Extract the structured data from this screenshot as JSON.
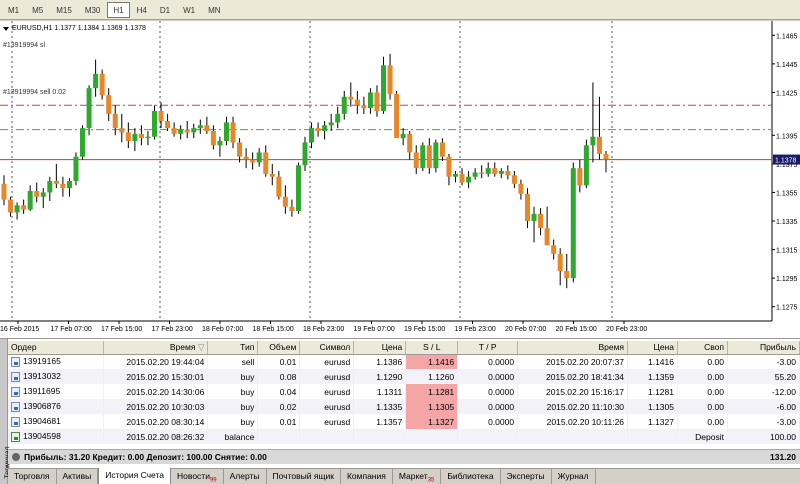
{
  "timeframes": [
    {
      "label": "M1",
      "active": false
    },
    {
      "label": "M5",
      "active": false
    },
    {
      "label": "M15",
      "active": false
    },
    {
      "label": "M30",
      "active": false
    },
    {
      "label": "H1",
      "active": true
    },
    {
      "label": "H4",
      "active": false
    },
    {
      "label": "D1",
      "active": false
    },
    {
      "label": "W1",
      "active": false
    },
    {
      "label": "MN",
      "active": false
    }
  ],
  "chart": {
    "title": "EURUSD,H1  1.1377 1.1384 1.1369 1.1378",
    "sl_label": "#13919994 sl",
    "order_label": "#13919994 sell 0.02",
    "current_price": "1.1378",
    "colors": {
      "bull": "#2ea82e",
      "bear": "#e8862a",
      "sl_line": "#cc4444",
      "order_line": "#44aa44",
      "bid_line": "#c04040"
    }
  },
  "chart_data": {
    "type": "candlestick",
    "symbol": "EURUSD",
    "timeframe": "H1",
    "ylim": [
      1.1265,
      1.1475
    ],
    "y_ticks": [
      "1.1465",
      "1.1445",
      "1.1425",
      "1.1395",
      "1.1375",
      "1.1355",
      "1.1335",
      "1.1315",
      "1.1295",
      "1.1275"
    ],
    "x_ticks": [
      "16 Feb 2015",
      "17 Feb 07:00",
      "17 Feb 15:00",
      "17 Feb 23:00",
      "18 Feb 07:00",
      "18 Feb 15:00",
      "18 Feb 23:00",
      "19 Feb 07:00",
      "19 Feb 15:00",
      "19 Feb 23:00",
      "20 Feb 07:00",
      "20 Feb 15:00",
      "20 Feb 23:00"
    ],
    "levels": {
      "stop_loss": 1.1416,
      "order_open": 1.1399,
      "bid": 1.1378
    },
    "candles": [
      [
        1.1361,
        1.1367,
        1.1346,
        1.135
      ],
      [
        1.135,
        1.1352,
        1.1338,
        1.1341
      ],
      [
        1.1341,
        1.1348,
        1.1336,
        1.1346
      ],
      [
        1.1346,
        1.135,
        1.134,
        1.1343
      ],
      [
        1.1343,
        1.136,
        1.1342,
        1.1356
      ],
      [
        1.1356,
        1.1362,
        1.1348,
        1.1352
      ],
      [
        1.1352,
        1.1358,
        1.1344,
        1.1355
      ],
      [
        1.1355,
        1.1366,
        1.1349,
        1.1363
      ],
      [
        1.1363,
        1.1375,
        1.1358,
        1.1361
      ],
      [
        1.1361,
        1.1366,
        1.1352,
        1.1358
      ],
      [
        1.1358,
        1.1365,
        1.1352,
        1.1363
      ],
      [
        1.1363,
        1.1383,
        1.136,
        1.138
      ],
      [
        1.138,
        1.1402,
        1.1378,
        1.14
      ],
      [
        1.14,
        1.143,
        1.1395,
        1.1428
      ],
      [
        1.1428,
        1.1448,
        1.1422,
        1.1438
      ],
      [
        1.1438,
        1.1441,
        1.142,
        1.1423
      ],
      [
        1.1423,
        1.1428,
        1.1405,
        1.141
      ],
      [
        1.141,
        1.1416,
        1.1395,
        1.14
      ],
      [
        1.14,
        1.141,
        1.139,
        1.1397
      ],
      [
        1.1397,
        1.1404,
        1.1386,
        1.1391
      ],
      [
        1.1391,
        1.14,
        1.1384,
        1.1396
      ],
      [
        1.1396,
        1.1402,
        1.1388,
        1.1393
      ],
      [
        1.1393,
        1.1398,
        1.1388,
        1.1394
      ],
      [
        1.1394,
        1.1416,
        1.1392,
        1.1412
      ],
      [
        1.1412,
        1.1418,
        1.14,
        1.1405
      ],
      [
        1.1405,
        1.141,
        1.1398,
        1.14
      ],
      [
        1.14,
        1.1404,
        1.1394,
        1.1396
      ],
      [
        1.1396,
        1.1402,
        1.1392,
        1.1399
      ],
      [
        1.1399,
        1.1405,
        1.1393,
        1.1397
      ],
      [
        1.1397,
        1.1403,
        1.1393,
        1.14
      ],
      [
        1.14,
        1.1406,
        1.1396,
        1.1402
      ],
      [
        1.1402,
        1.1408,
        1.1396,
        1.1398
      ],
      [
        1.1398,
        1.1402,
        1.1385,
        1.1388
      ],
      [
        1.1388,
        1.1394,
        1.138,
        1.1391
      ],
      [
        1.1391,
        1.1408,
        1.1388,
        1.1404
      ],
      [
        1.1404,
        1.1408,
        1.1386,
        1.139
      ],
      [
        1.139,
        1.1393,
        1.1376,
        1.138
      ],
      [
        1.138,
        1.1386,
        1.1372,
        1.1378
      ],
      [
        1.1378,
        1.1383,
        1.1371,
        1.1376
      ],
      [
        1.1376,
        1.1386,
        1.1373,
        1.1383
      ],
      [
        1.1383,
        1.1388,
        1.1366,
        1.1368
      ],
      [
        1.1368,
        1.1375,
        1.136,
        1.1366
      ],
      [
        1.1366,
        1.137,
        1.135,
        1.1352
      ],
      [
        1.1352,
        1.136,
        1.134,
        1.1345
      ],
      [
        1.1345,
        1.135,
        1.1338,
        1.1342
      ],
      [
        1.1342,
        1.1376,
        1.134,
        1.1374
      ],
      [
        1.1374,
        1.1394,
        1.137,
        1.139
      ],
      [
        1.139,
        1.1404,
        1.1386,
        1.14
      ],
      [
        1.14,
        1.1404,
        1.1394,
        1.1398
      ],
      [
        1.1398,
        1.1405,
        1.1392,
        1.1402
      ],
      [
        1.1402,
        1.141,
        1.1398,
        1.1404
      ],
      [
        1.1404,
        1.1415,
        1.14,
        1.141
      ],
      [
        1.141,
        1.1426,
        1.1406,
        1.1422
      ],
      [
        1.1422,
        1.1432,
        1.1415,
        1.142
      ],
      [
        1.142,
        1.1426,
        1.141,
        1.1416
      ],
      [
        1.1416,
        1.1422,
        1.141,
        1.1414
      ],
      [
        1.1414,
        1.1428,
        1.141,
        1.1425
      ],
      [
        1.1425,
        1.143,
        1.1408,
        1.1412
      ],
      [
        1.1412,
        1.145,
        1.141,
        1.1444
      ],
      [
        1.1444,
        1.1452,
        1.142,
        1.1424
      ],
      [
        1.1424,
        1.1426,
        1.14,
        1.1393
      ],
      [
        1.1393,
        1.14,
        1.1388,
        1.1396
      ],
      [
        1.1396,
        1.1398,
        1.1378,
        1.1383
      ],
      [
        1.1383,
        1.1388,
        1.1368,
        1.1372
      ],
      [
        1.1372,
        1.139,
        1.137,
        1.1388
      ],
      [
        1.1388,
        1.1393,
        1.1368,
        1.1372
      ],
      [
        1.1372,
        1.1392,
        1.1369,
        1.139
      ],
      [
        1.139,
        1.1393,
        1.1377,
        1.138
      ],
      [
        1.138,
        1.1382,
        1.136,
        1.1366
      ],
      [
        1.1366,
        1.137,
        1.1362,
        1.1368
      ],
      [
        1.1368,
        1.1372,
        1.136,
        1.1362
      ],
      [
        1.1362,
        1.137,
        1.1358,
        1.1366
      ],
      [
        1.1366,
        1.1372,
        1.1364,
        1.1369
      ],
      [
        1.1369,
        1.1374,
        1.1365,
        1.1368
      ],
      [
        1.1368,
        1.1376,
        1.1366,
        1.1372
      ],
      [
        1.1372,
        1.1376,
        1.1366,
        1.1368
      ],
      [
        1.1368,
        1.1372,
        1.1365,
        1.137
      ],
      [
        1.137,
        1.1374,
        1.1364,
        1.1367
      ],
      [
        1.1367,
        1.137,
        1.1358,
        1.1361
      ],
      [
        1.1361,
        1.1364,
        1.135,
        1.1354
      ],
      [
        1.1354,
        1.1358,
        1.133,
        1.1335
      ],
      [
        1.1335,
        1.1345,
        1.132,
        1.134
      ],
      [
        1.134,
        1.1344,
        1.1325,
        1.133
      ],
      [
        1.133,
        1.1345,
        1.1322,
        1.1318
      ],
      [
        1.1318,
        1.1322,
        1.1308,
        1.1312
      ],
      [
        1.1312,
        1.1316,
        1.129,
        1.13
      ],
      [
        1.13,
        1.1312,
        1.1288,
        1.1295
      ],
      [
        1.1295,
        1.1376,
        1.1292,
        1.1372
      ],
      [
        1.1372,
        1.1378,
        1.1355,
        1.136
      ],
      [
        1.136,
        1.1392,
        1.1358,
        1.1388
      ],
      [
        1.1388,
        1.1432,
        1.1376,
        1.1394
      ],
      [
        1.1394,
        1.1422,
        1.1378,
        1.1382
      ],
      [
        1.1382,
        1.1384,
        1.1369,
        1.1378
      ]
    ]
  },
  "columns": {
    "order": "Ордер",
    "time": "Время",
    "type": "Тип",
    "volume": "Объем",
    "symbol": "Символ",
    "price": "Цена",
    "sl": "S / L",
    "tp": "T / P",
    "close_time": "Время",
    "close_price": "Цена",
    "swap": "Своп",
    "profit": "Прибыль"
  },
  "rows": [
    {
      "order": "13919165",
      "time": "2015.02.20 19:44:04",
      "type": "sell",
      "volume": "0.01",
      "symbol": "eurusd",
      "price": "1.1386",
      "sl": "1.1416",
      "tp": "0.0000",
      "close_time": "2015.02.20 20:07:37",
      "close_price": "1.1416",
      "swap": "0.00",
      "profit": "-3.00",
      "sl_hit": true,
      "icon": "order"
    },
    {
      "order": "13913032",
      "time": "2015.02.20 15:30:01",
      "type": "buy",
      "volume": "0.08",
      "symbol": "eurusd",
      "price": "1.1290",
      "sl": "1.1260",
      "tp": "0.0000",
      "close_time": "2015.02.20 18:41:34",
      "close_price": "1.1359",
      "swap": "0.00",
      "profit": "55.20",
      "sl_hit": false,
      "icon": "order"
    },
    {
      "order": "13911695",
      "time": "2015.02.20 14:30:06",
      "type": "buy",
      "volume": "0.04",
      "symbol": "eurusd",
      "price": "1.1311",
      "sl": "1.1281",
      "tp": "0.0000",
      "close_time": "2015.02.20 15:16:17",
      "close_price": "1.1281",
      "swap": "0.00",
      "profit": "-12.00",
      "sl_hit": true,
      "icon": "order"
    },
    {
      "order": "13906876",
      "time": "2015.02.20 10:30:03",
      "type": "buy",
      "volume": "0.02",
      "symbol": "eurusd",
      "price": "1.1335",
      "sl": "1.1305",
      "tp": "0.0000",
      "close_time": "2015.02.20 11:10:30",
      "close_price": "1.1305",
      "swap": "0.00",
      "profit": "-6.00",
      "sl_hit": true,
      "icon": "order"
    },
    {
      "order": "13904681",
      "time": "2015.02.20 08:30:14",
      "type": "buy",
      "volume": "0.01",
      "symbol": "eurusd",
      "price": "1.1357",
      "sl": "1.1327",
      "tp": "0.0000",
      "close_time": "2015.02.20 10:11:26",
      "close_price": "1.1327",
      "swap": "0.00",
      "profit": "-3.00",
      "sl_hit": true,
      "icon": "order"
    },
    {
      "order": "13904598",
      "time": "2015.02.20 08:26:32",
      "type": "balance",
      "volume": "",
      "symbol": "",
      "price": "",
      "sl": "",
      "tp": "",
      "close_time": "",
      "close_price": "",
      "swap": "Deposit",
      "profit": "100.00",
      "sl_hit": false,
      "icon": "balance"
    }
  ],
  "summary": {
    "text": "Прибыль: 31.20  Кредит: 0.00  Депозит: 100.00  Снятие: 0.00",
    "total": "131.20"
  },
  "side_label": "Терминал",
  "tabs": [
    {
      "label": "Торговля",
      "active": false,
      "badge": ""
    },
    {
      "label": "Активы",
      "active": false,
      "badge": ""
    },
    {
      "label": "История Счета",
      "active": true,
      "badge": ""
    },
    {
      "label": "Новости",
      "active": false,
      "badge": "99"
    },
    {
      "label": "Алерты",
      "active": false,
      "badge": ""
    },
    {
      "label": "Почтовый ящик",
      "active": false,
      "badge": ""
    },
    {
      "label": "Компания",
      "active": false,
      "badge": ""
    },
    {
      "label": "Маркет",
      "active": false,
      "badge": "35"
    },
    {
      "label": "Библиотека",
      "active": false,
      "badge": ""
    },
    {
      "label": "Эксперты",
      "active": false,
      "badge": ""
    },
    {
      "label": "Журнал",
      "active": false,
      "badge": ""
    }
  ]
}
